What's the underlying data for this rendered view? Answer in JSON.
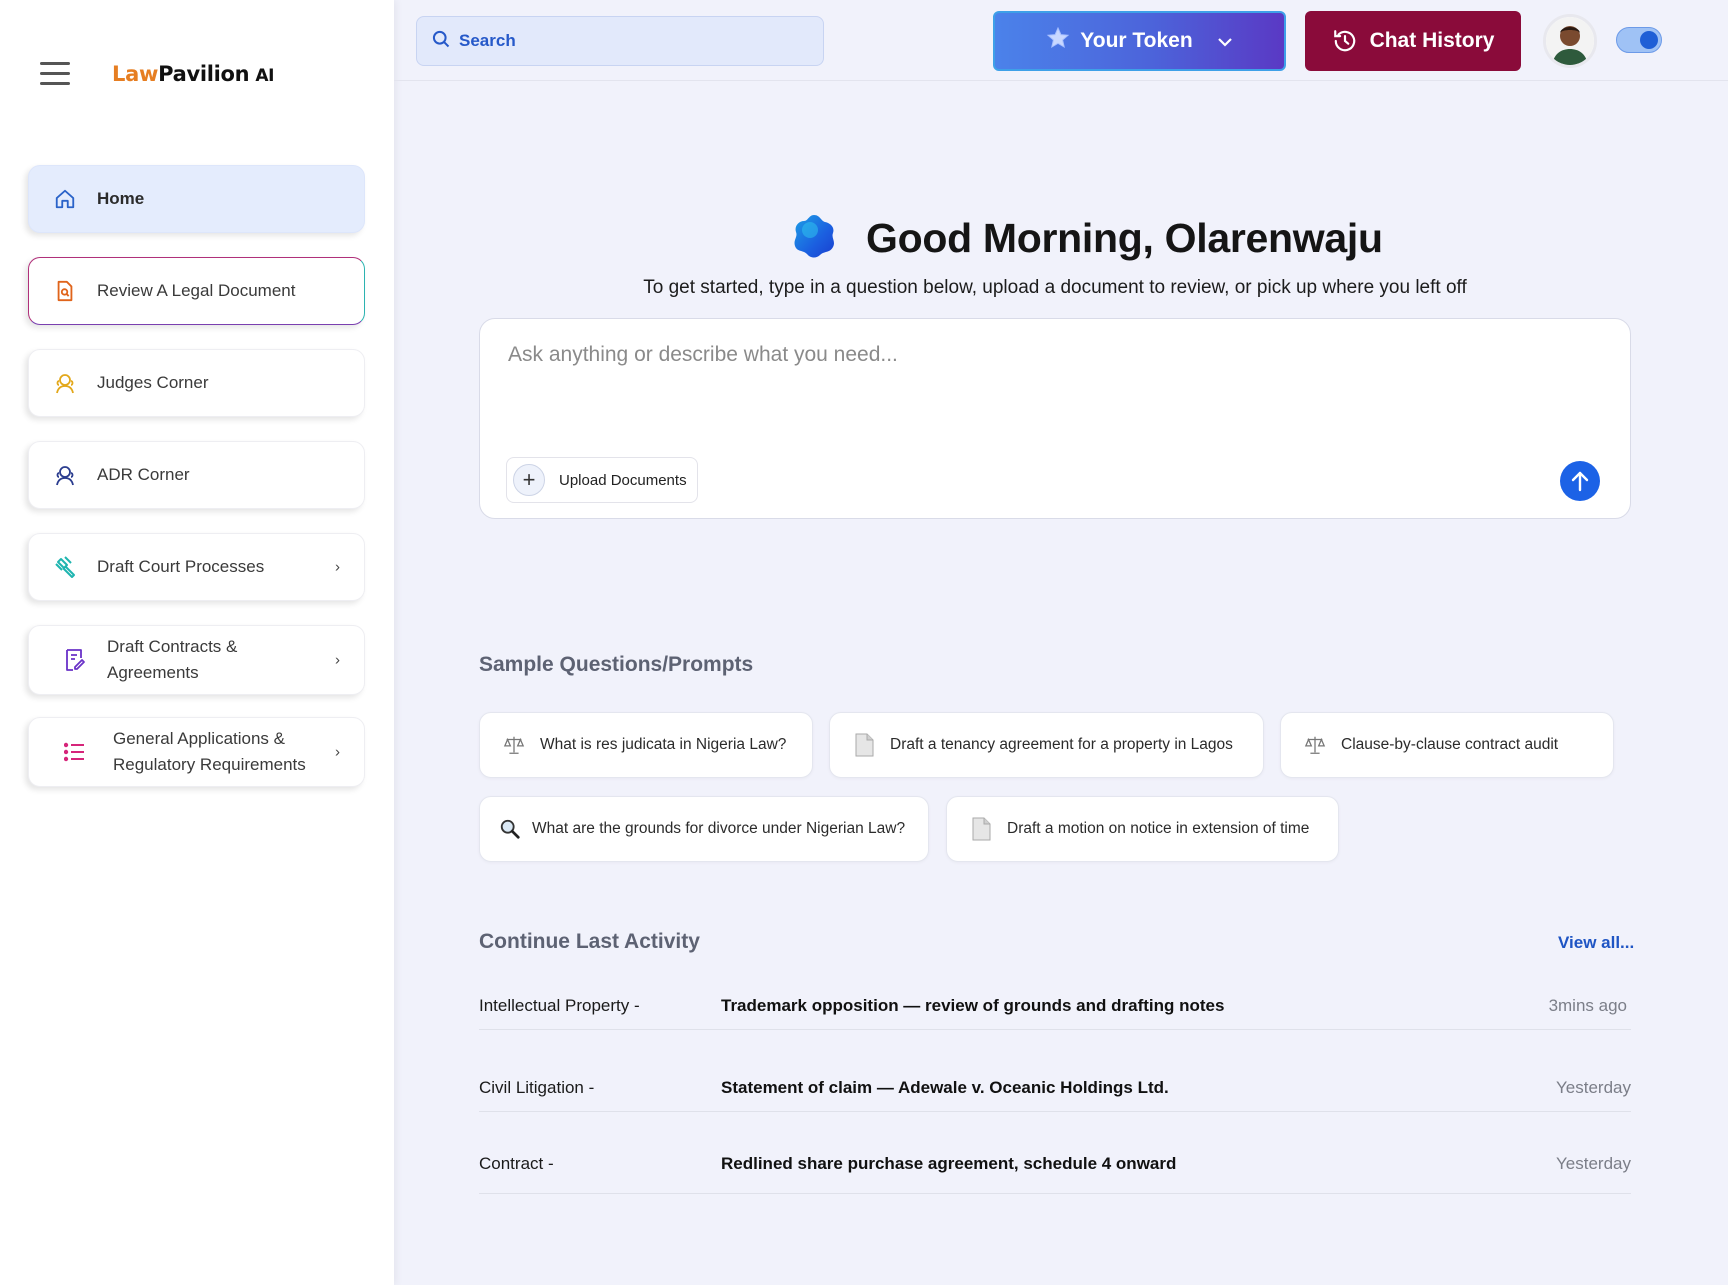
{
  "sidebar": {
    "logo": {
      "part1": "Law",
      "part2": "Pavilion",
      "suffix": "AI"
    },
    "items": [
      {
        "label": "Home"
      },
      {
        "label": "Review A Legal Document"
      },
      {
        "label": "Judges Corner"
      },
      {
        "label": "ADR Corner"
      },
      {
        "label": "Draft Court Processes",
        "chevron": "›"
      },
      {
        "label": "Draft Contracts & Agreements",
        "chevron": "›"
      },
      {
        "label": "General Applications & Regulatory Requirements",
        "chevron": "›"
      }
    ]
  },
  "topbar": {
    "search_placeholder": "Search",
    "token_label": "Your Token",
    "history_label": "Chat History"
  },
  "main": {
    "greeting": "Good Morning, Olarenwaju",
    "subtitle": "To get started, type in a question below, upload a document to review, or pick up where you left off",
    "ask_placeholder": "Ask anything or describe what you need...",
    "upload_label": "Upload Documents",
    "samples_title": "Sample Questions/Prompts",
    "samples": [
      {
        "label": "What is res judicata in Nigeria Law?",
        "icon": "scales-icon"
      },
      {
        "label": "Draft a tenancy agreement for a property in Lagos",
        "icon": "document-icon"
      },
      {
        "label": "Clause-by-clause contract audit",
        "icon": "scales-icon"
      },
      {
        "label": "What are the grounds for divorce under Nigerian Law?",
        "icon": "magnifier-icon"
      },
      {
        "label": "Draft a motion on notice in extension of time",
        "icon": "document-icon"
      }
    ],
    "activity_title": "Continue Last Activity",
    "view_all": "View all...",
    "activity": [
      {
        "category": "Intellectual Property -",
        "description": "Trademark opposition — review of grounds and drafting notes",
        "time": "3mins ago"
      },
      {
        "category": "Civil Litigation -",
        "description": "Statement of claim — Adewale v. Oceanic Holdings Ltd.",
        "time": "Yesterday"
      },
      {
        "category": "Contract -",
        "description": "Redlined share purchase agreement, schedule 4 onward",
        "time": "Yesterday"
      }
    ]
  },
  "colors": {
    "accent_blue": "#1c62e6",
    "history_maroon": "#8a0b3a",
    "logo_orange": "#e67e22"
  }
}
